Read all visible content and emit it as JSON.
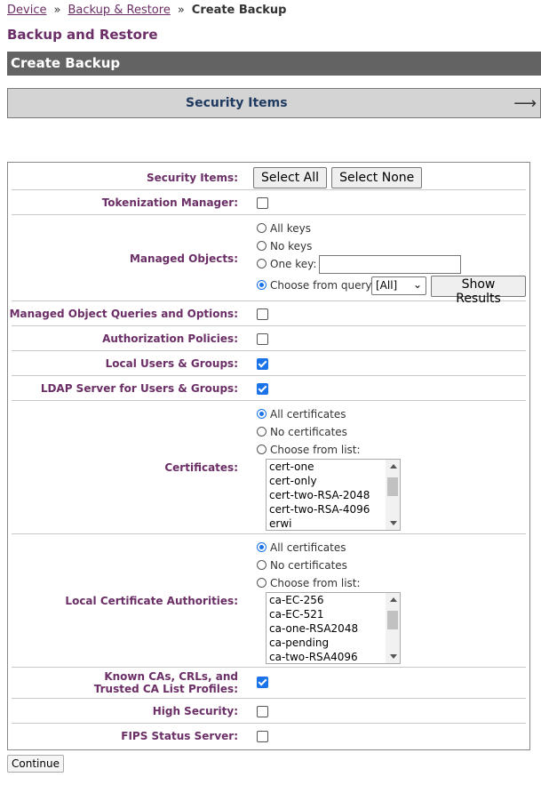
{
  "breadcrumb": {
    "device": "Device",
    "backup_restore": "Backup & Restore",
    "current": "Create Backup",
    "separator": "»"
  },
  "page_title": "Backup and Restore",
  "section_title": "Create Backup",
  "collapse": {
    "label": "Security Items",
    "icon": "right-arrow-icon"
  },
  "rows": {
    "security_items": {
      "label": "Security Items:",
      "select_all": "Select All",
      "select_none": "Select None"
    },
    "tokenization": {
      "label": "Tokenization Manager:",
      "checked": false
    },
    "managed_objects": {
      "label": "Managed Objects:",
      "all_keys": "All keys",
      "no_keys": "No keys",
      "one_key": "One key:",
      "one_key_value": "",
      "choose_query": "Choose from query:",
      "query_selected": "[All]",
      "show_results": "Show Results",
      "selected": "choose_query"
    },
    "queries_options": {
      "label": "Managed Object Queries and Options:",
      "checked": false
    },
    "authorization": {
      "label": "Authorization Policies:",
      "checked": false
    },
    "local_users": {
      "label": "Local Users & Groups:",
      "checked": true
    },
    "ldap": {
      "label": "LDAP Server for Users & Groups:",
      "checked": true
    },
    "certificates": {
      "label": "Certificates:",
      "all": "All certificates",
      "none": "No certificates",
      "choose": "Choose from list:",
      "selected": "all",
      "items": [
        "cert-one",
        "cert-only",
        "cert-two-RSA-2048",
        "cert-two-RSA-4096",
        "erwi"
      ]
    },
    "local_cas": {
      "label": "Local Certificate Authorities:",
      "all": "All certificates",
      "none": "No certificates",
      "choose": "Choose from list:",
      "selected": "all",
      "items": [
        "ca-EC-256",
        "ca-EC-521",
        "ca-one-RSA2048",
        "ca-pending",
        "ca-two-RSA4096"
      ]
    },
    "known_cas": {
      "label_line1": "Known CAs, CRLs, and",
      "label_line2": "Trusted CA List Profiles:",
      "checked": true
    },
    "high_security": {
      "label": "High Security:",
      "checked": false
    },
    "fips": {
      "label": "FIPS Status Server:",
      "checked": false
    }
  },
  "continue_label": "Continue",
  "colors": {
    "accent": "#6b2e66",
    "bar": "#636363",
    "checkbox": "#1a73e8",
    "collapse_text": "#1f3a60"
  }
}
